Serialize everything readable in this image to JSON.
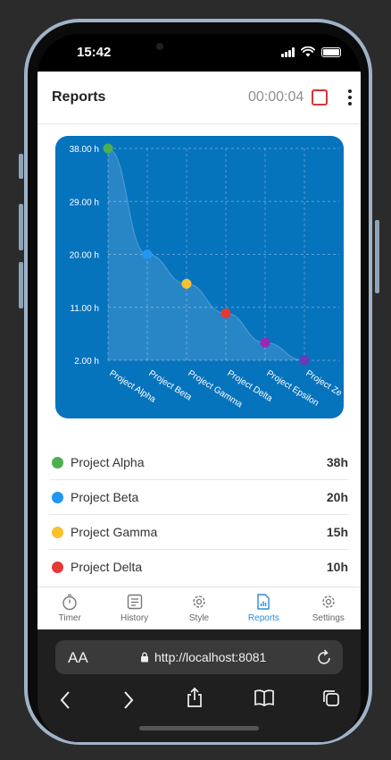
{
  "status": {
    "time": "15:42"
  },
  "header": {
    "title": "Reports",
    "timer": "00:00:04"
  },
  "chart_data": {
    "type": "area",
    "categories": [
      "Project Alpha",
      "Project Beta",
      "Project Gamma",
      "Project Delta",
      "Project Epsilon",
      "Project Zeta"
    ],
    "values": [
      38,
      20,
      15,
      10,
      5,
      2
    ],
    "point_colors": [
      "#4caf50",
      "#2196f3",
      "#fbc02d",
      "#e53935",
      "#9c27b0",
      "#673ab7"
    ],
    "y_ticks": [
      "38.00 h",
      "29.00 h",
      "20.00 h",
      "11.00 h",
      "2.00 h"
    ],
    "x_tick_labels": [
      "Project Alpha",
      "Project Beta",
      "Project Gamma",
      "Project Delta",
      "Project Epsilon",
      "Project Ze"
    ],
    "ylim": [
      2,
      38
    ],
    "grid": true,
    "background": "#0673bd"
  },
  "legend": [
    {
      "name": "Project Alpha",
      "value": "38h",
      "color": "#4caf50"
    },
    {
      "name": "Project Beta",
      "value": "20h",
      "color": "#2196f3"
    },
    {
      "name": "Project Gamma",
      "value": "15h",
      "color": "#fbc02d"
    },
    {
      "name": "Project Delta",
      "value": "10h",
      "color": "#e53935"
    }
  ],
  "tabs": [
    {
      "label": "Timer",
      "icon": "stopwatch-icon"
    },
    {
      "label": "History",
      "icon": "history-icon"
    },
    {
      "label": "Style",
      "icon": "gear-icon"
    },
    {
      "label": "Reports",
      "icon": "report-icon",
      "active": true
    },
    {
      "label": "Settings",
      "icon": "gear-icon"
    }
  ],
  "browser": {
    "aa": "AA",
    "url": "http://localhost:8081"
  },
  "colors": {
    "accent": "#2a8ad8",
    "stop": "#d33636"
  }
}
